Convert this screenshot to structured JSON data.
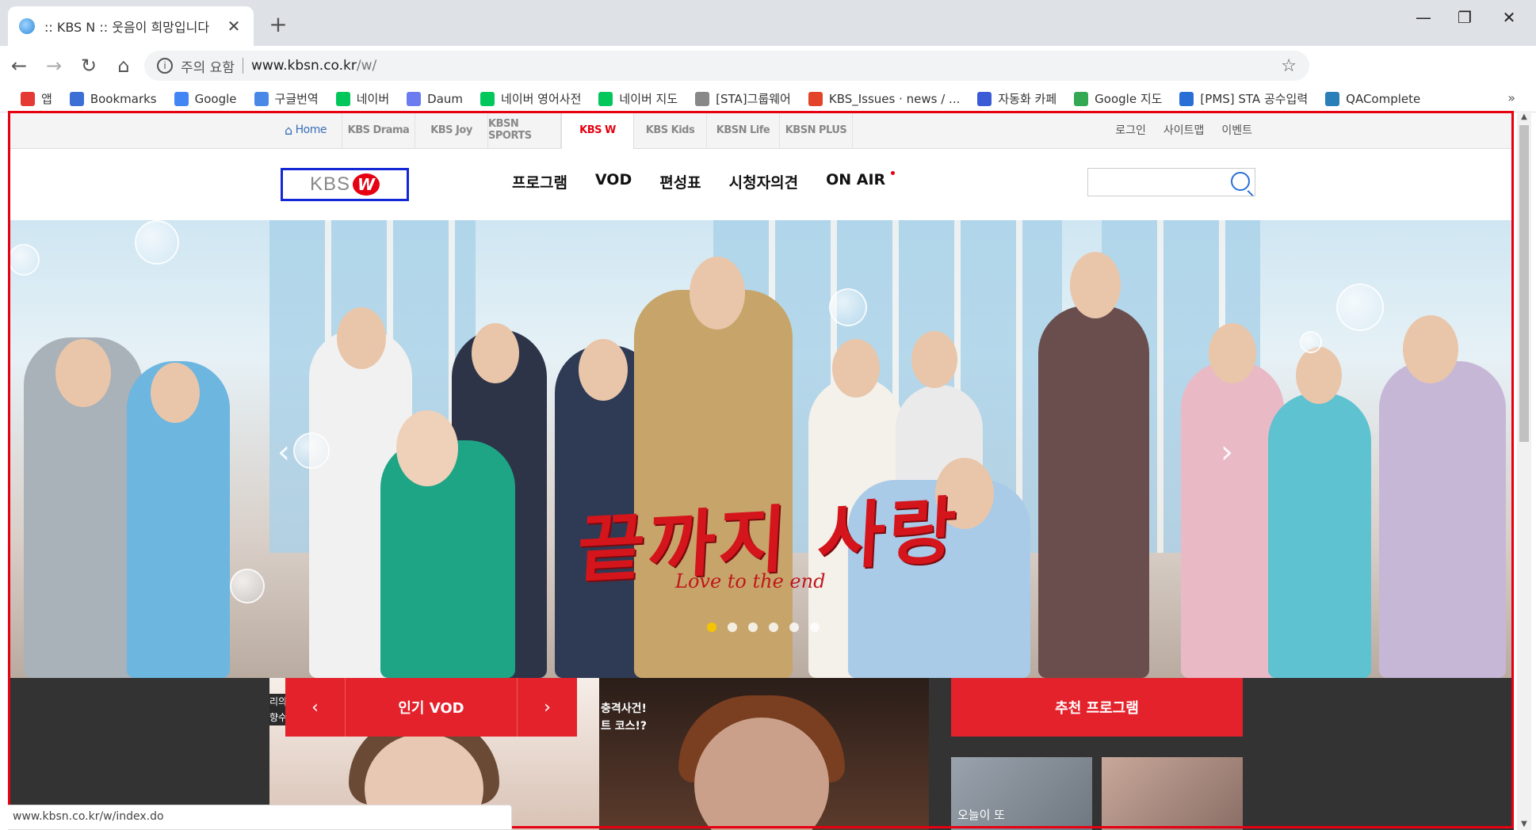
{
  "browser": {
    "tab_title": ":: KBS N :: 웃음이 희망입니다",
    "tab_close": "✕",
    "new_tab": "+",
    "window_minimize": "—",
    "window_restore": "❐",
    "window_close": "✕",
    "security_label": "주의 요함",
    "url_host": "www.kbsn.co.kr",
    "url_path": "/w/",
    "status_url": "www.kbsn.co.kr/w/index.do"
  },
  "bookmarks": [
    {
      "label": "앱",
      "icon": "apps-icon",
      "color": "#e53935"
    },
    {
      "label": "Bookmarks",
      "icon": "star-icon",
      "color": "#3b6fd6"
    },
    {
      "label": "Google",
      "icon": "google-icon",
      "color": "#4285f4"
    },
    {
      "label": "구글번역",
      "icon": "translate-icon",
      "color": "#4a88e8"
    },
    {
      "label": "네이버",
      "icon": "naver-icon",
      "color": "#03c75a"
    },
    {
      "label": "Daum",
      "icon": "daum-icon",
      "color": "#6b7cf0"
    },
    {
      "label": "네이버 영어사전",
      "icon": "dict-icon",
      "color": "#03c75a"
    },
    {
      "label": "네이버 지도",
      "icon": "naver-icon",
      "color": "#03c75a"
    },
    {
      "label": "[STA]그룹웨어",
      "icon": "page-icon",
      "color": "#888888"
    },
    {
      "label": "KBS_Issues · news / ...",
      "icon": "gitlab-icon",
      "color": "#e24329"
    },
    {
      "label": "자동화 카페",
      "icon": "sta-icon",
      "color": "#3b5bd6"
    },
    {
      "label": "Google 지도",
      "icon": "maps-icon",
      "color": "#34a853"
    },
    {
      "label": "[PMS] STA 공수입력",
      "icon": "pms-icon",
      "color": "#2a6fd6"
    },
    {
      "label": "QAComplete",
      "icon": "qa-icon",
      "color": "#2a7fb8"
    }
  ],
  "bookmarks_more": "»",
  "site": {
    "channels": [
      "Home",
      "KBS Drama",
      "KBS Joy",
      "KBSN SPORTS",
      "KBS W",
      "KBS Kids",
      "KBSN Life",
      "KBSN PLUS"
    ],
    "active_channel": "KBS W",
    "util_links": [
      "로그인",
      "사이트맵",
      "이벤트"
    ],
    "logo_text": "KBS",
    "logo_badge": "W",
    "menu": [
      "프로그램",
      "VOD",
      "편성표",
      "시청자의견",
      "ON AIR"
    ],
    "search_placeholder": "",
    "hero": {
      "title": "끝까지 사랑",
      "subtitle": "Love to the end",
      "prev": "‹",
      "next": "›",
      "slide_count": 6,
      "active_slide": 1
    },
    "popular_vod": {
      "label": "인기 VOD",
      "prev": "‹",
      "next": "›"
    },
    "thumb1_caption": "리의\n향수",
    "thumb2_caption": "충격사건!\n트 코스!?",
    "recommended": {
      "label": "추천 프로그램"
    },
    "rec1_caption": "오늘이 또"
  },
  "colors": {
    "brand_red": "#e4222c",
    "frame_red": "#e60012",
    "logo_border": "#1427d6",
    "dot_active": "#f5c400"
  }
}
